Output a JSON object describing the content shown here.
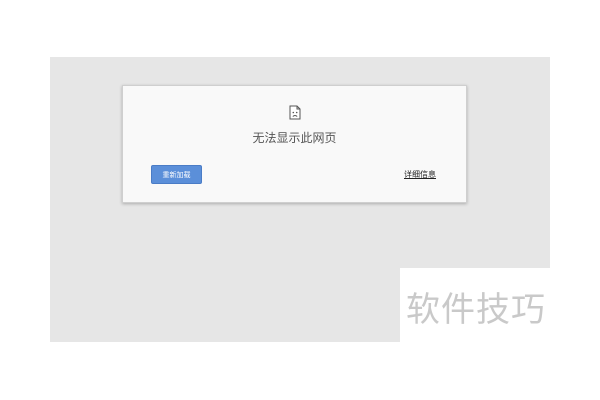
{
  "error_page": {
    "message": "无法显示此网页",
    "reload_label": "重新加载",
    "details_label": "详细信息",
    "icon": "broken-page-icon"
  },
  "watermark": {
    "text": "软件技巧"
  },
  "colors": {
    "screen_bg": "#e6e6e6",
    "card_bg": "#f9f9f9",
    "button_bg": "#5b8fd9",
    "watermark": "#c9c9c9"
  }
}
